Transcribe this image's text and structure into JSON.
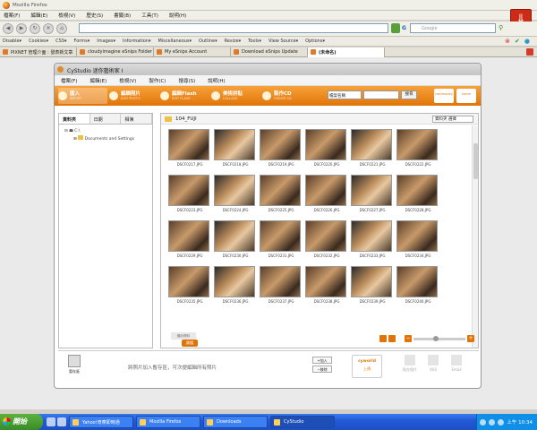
{
  "browser": {
    "window_title": "Mozilla Firefox",
    "menu": [
      "檔案(F)",
      "編輯(E)",
      "檢視(V)",
      "歷史(S)",
      "書籤(B)",
      "工具(T)",
      "說明(H)"
    ],
    "search_placeholder": "Google",
    "search_engine_badge": "G"
  },
  "devbar": {
    "items": [
      "Disable▾",
      "Cookies▾",
      "CSS▾",
      "Forms▾",
      "Images▾",
      "Information▾",
      "Miscellaneous▾",
      "Outline▾",
      "Resize▾",
      "Tools▾",
      "View Source▾",
      "Options▾"
    ]
  },
  "tabs": [
    {
      "label": "PIXNET 管理介面 : 發表新文章"
    },
    {
      "label": "cloudyimagine eSnips Folder"
    },
    {
      "label": "My eSnips Account"
    },
    {
      "label": "Download eSnips Update"
    },
    {
      "label": "(未命名)",
      "active": true
    }
  ],
  "app": {
    "title": "CyStudio 迷你藝術家 I",
    "menu": [
      "檔案(F)",
      "編輯(E)",
      "檢視(V)",
      "製作(C)",
      "搜尋(S)",
      "說明(H)"
    ],
    "toolbar": [
      {
        "label": "匯入",
        "sub": "IMPORT",
        "selected": true
      },
      {
        "label": "編輯照片",
        "sub": "EDIT PHOTO"
      },
      {
        "label": "編輯Flash",
        "sub": "EDIT FLASH"
      },
      {
        "label": "美術拼貼",
        "sub": "COLLAGE"
      },
      {
        "label": "製作CD",
        "sub": "CREATE CD"
      }
    ],
    "search_select": "檔案名稱",
    "search_button": "搜尋",
    "logo_community": "community",
    "logo_home": "home",
    "left_tabs": [
      "資料夾",
      "日期",
      "相簿"
    ],
    "tree": [
      "C:\\",
      "Documents and Settings"
    ],
    "folder_name": "104_FUJI",
    "sort_label": "資料夾 選擇",
    "photos": [
      "DSCF0217.JPG",
      "DSCF0218.JPG",
      "DSCF0219.JPG",
      "DSCF0220.JPG",
      "DSCF0221.JPG",
      "DSCF0222.JPG",
      "DSCF0223.JPG",
      "DSCF0224.JPG",
      "DSCF0225.JPG",
      "DSCF0226.JPG",
      "DSCF0227.JPG",
      "DSCF0228.JPG",
      "DSCF0229.JPG",
      "DSCF0230.JPG",
      "DSCF0231.JPG",
      "DSCF0232.JPG",
      "DSCF0233.JPG",
      "DSCF0234.JPG",
      "DSCF0235.JPG",
      "DSCF0236.JPG",
      "DSCF0237.JPG",
      "DSCF0238.JPG",
      "DSCF0239.JPG",
      "DSCF0240.JPG"
    ],
    "status_label": "顯示資料",
    "status_badge": "跳檔",
    "zoom_minus": "−",
    "zoom_plus": "+",
    "staging_label": "暫存區",
    "hint": "將照片加入暫存區，可次便編輯所有照片",
    "add_button": "+加入",
    "remove_button": "−移除",
    "upload_label": "上傳",
    "upload_logo": "cyworld",
    "actions": [
      "貼在相片",
      "列印",
      "Email"
    ]
  },
  "taskbar": {
    "start": "開始",
    "tasks": [
      {
        "label": "Yahoo!奇摩即時通"
      },
      {
        "label": "Mozilla Firefox"
      },
      {
        "label": "Downloads"
      },
      {
        "label": "CyStudio",
        "active": true
      }
    ],
    "clock": "上午 10:34"
  }
}
